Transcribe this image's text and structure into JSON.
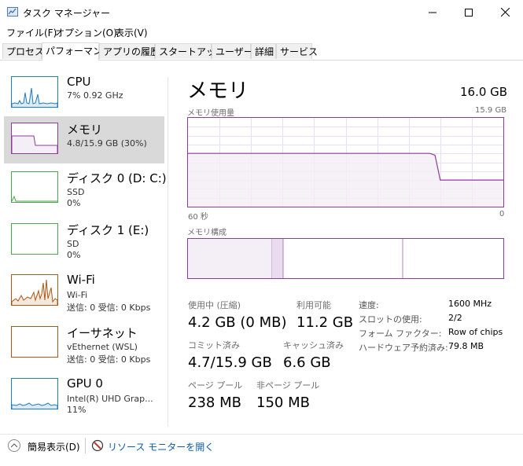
{
  "window": {
    "title": "タスク マネージャー",
    "minimize": "—",
    "maximize": "☐",
    "close": "✕"
  },
  "menu": [
    "ファイル(F)",
    "オプション(O)",
    "表示(V)"
  ],
  "tabs": [
    {
      "label": "プロセス",
      "active": false
    },
    {
      "label": "パフォーマンス",
      "active": true
    },
    {
      "label": "アプリの履歴",
      "active": false
    },
    {
      "label": "スタートアップ",
      "active": false
    },
    {
      "label": "ユーザー",
      "active": false
    },
    {
      "label": "詳細",
      "active": false
    },
    {
      "label": "サービス",
      "active": false
    }
  ],
  "sidebar": {
    "items": [
      {
        "title": "CPU",
        "line2": "7%  0.92 GHz",
        "line3": "",
        "color": "#1f7dc1",
        "selected": false
      },
      {
        "title": "メモリ",
        "line2": "4.8/15.9 GB (30%)",
        "line3": "",
        "color": "#8b3c9a",
        "selected": true
      },
      {
        "title": "ディスク 0 (D: C:)",
        "line2": "SSD",
        "line3": "0%",
        "color": "#4da54d",
        "selected": false
      },
      {
        "title": "ディスク 1 (E:)",
        "line2": "SD",
        "line3": "0%",
        "color": "#4da54d",
        "selected": false
      },
      {
        "title": "Wi-Fi",
        "line2": "Wi-Fi",
        "line3": "送信: 0 受信: 0 Kbps",
        "color": "#a7591a",
        "selected": false
      },
      {
        "title": "イーサネット",
        "line2": "vEthernet (WSL)",
        "line3": "送信: 0 受信: 0 Kbps",
        "color": "#a7591a",
        "selected": false
      },
      {
        "title": "GPU 0",
        "line2": "Intel(R) UHD Grap...",
        "line3": "11%",
        "color": "#1f7dc1",
        "selected": false
      }
    ]
  },
  "main": {
    "title": "メモリ",
    "total": "16.0 GB",
    "usage_label": "メモリ使用量",
    "usage_max": "15.9 GB",
    "time_left": "60 秒",
    "time_right": "0",
    "composition_label": "メモリ構成",
    "usage_series_fraction": [
      0.6,
      0.6,
      0.6,
      0.6,
      0.6,
      0.6,
      0.6,
      0.6,
      0.6,
      0.6,
      0.6,
      0.6,
      0.6,
      0.6,
      0.6,
      0.6,
      0.6,
      0.6,
      0.6,
      0.6,
      0.6,
      0.6,
      0.6,
      0.6,
      0.6,
      0.6,
      0.6,
      0.6,
      0.6,
      0.6,
      0.6,
      0.6,
      0.6,
      0.6,
      0.6,
      0.6,
      0.6,
      0.6,
      0.6,
      0.6,
      0.6,
      0.6,
      0.6,
      0.6,
      0.6,
      0.6,
      0.6,
      0.58,
      0.3,
      0.3,
      0.3,
      0.3,
      0.3,
      0.3,
      0.3,
      0.3,
      0.3,
      0.3,
      0.3,
      0.3,
      0.3
    ],
    "stats": {
      "in_use_label": "使用中 (圧縮)",
      "in_use_value": "4.2 GB (0 MB)",
      "available_label": "利用可能",
      "available_value": "11.2 GB",
      "committed_label": "コミット済み",
      "committed_value": "4.7/15.9 GB",
      "cached_label": "キャッシュ済み",
      "cached_value": "6.6 GB",
      "paged_label": "ページ プール",
      "paged_value": "238 MB",
      "nonpaged_label": "非ページ プール",
      "nonpaged_value": "150 MB"
    },
    "details": [
      {
        "key": "速度:",
        "value": "1600 MHz"
      },
      {
        "key": "スロットの使用:",
        "value": "2/2"
      },
      {
        "key": "フォーム ファクター:",
        "value": "Row of chips"
      },
      {
        "key": "ハードウェア予約済み:",
        "value": "79.8 MB"
      }
    ]
  },
  "footer": {
    "fewer_details": "簡易表示(D)",
    "resource_monitor": "リソース モニターを開く"
  },
  "colors": {
    "memory": "#8b3c9a",
    "memory_fill": "#f4eef6",
    "grid": "#e8dff0",
    "link": "#0b5cab"
  }
}
